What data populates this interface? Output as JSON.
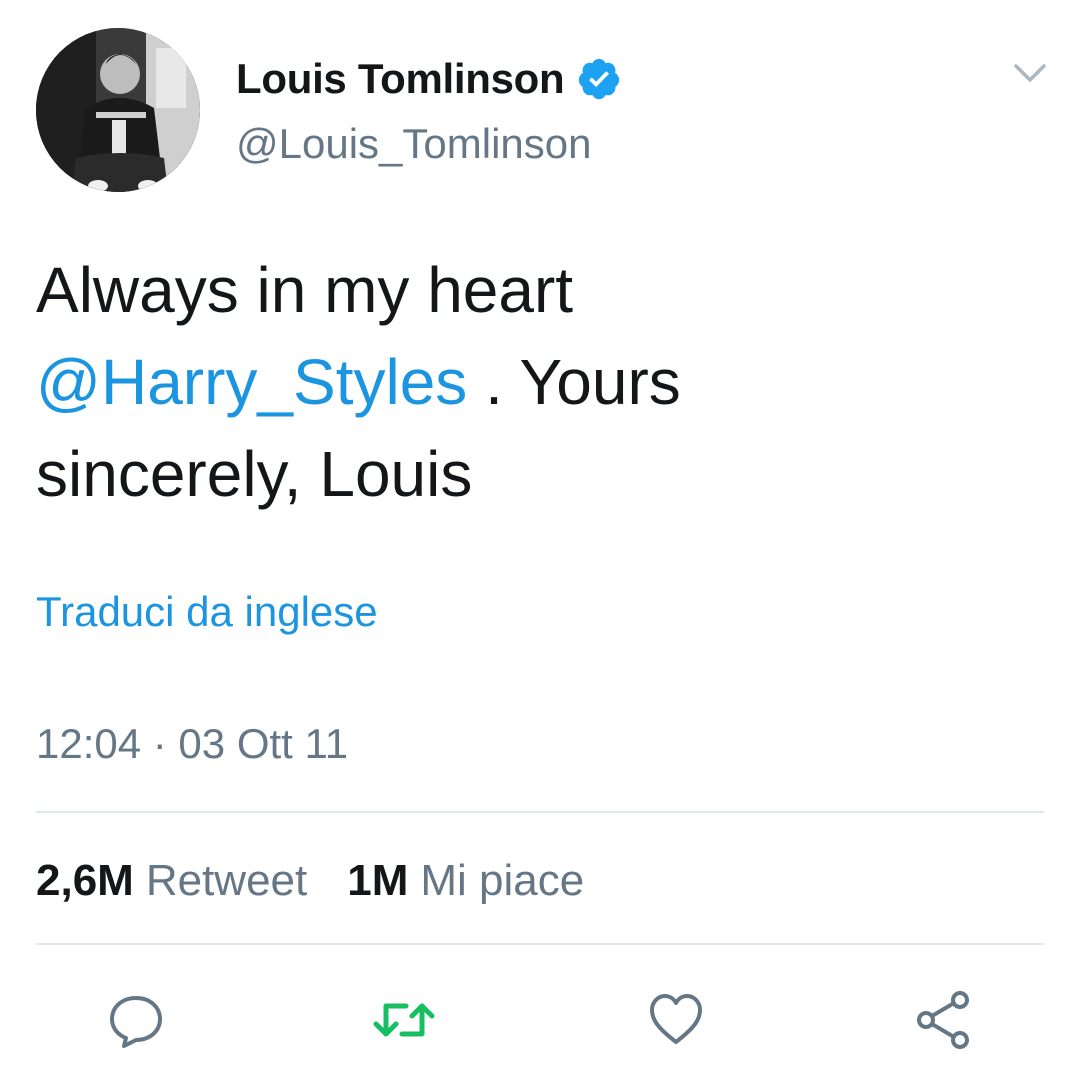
{
  "user": {
    "display_name": "Louis Tomlinson",
    "handle": "@Louis_Tomlinson",
    "verified": true,
    "avatar_icon": "profile-photo"
  },
  "tweet": {
    "text_before": "Always in my heart ",
    "mention": "@Harry_Styles",
    "text_after": " . Yours sincerely, Louis",
    "translate_link": "Traduci da inglese",
    "timestamp": "12:04 · 03 Ott 11"
  },
  "stats": {
    "retweets_count": "2,6M",
    "retweets_label": "Retweet",
    "likes_count": "1M",
    "likes_label": "Mi piace"
  },
  "actions": [
    {
      "name": "reply",
      "icon": "reply-icon"
    },
    {
      "name": "retweet",
      "icon": "retweet-icon",
      "active": true
    },
    {
      "name": "like",
      "icon": "heart-icon"
    },
    {
      "name": "share",
      "icon": "share-icon"
    }
  ],
  "colors": {
    "link": "#1b95e0",
    "secondary_text": "#657786",
    "primary_text": "#14171a",
    "retweet_active": "#17bf63",
    "verified_badge": "#1da1f2",
    "divider": "#e1e8ed"
  }
}
